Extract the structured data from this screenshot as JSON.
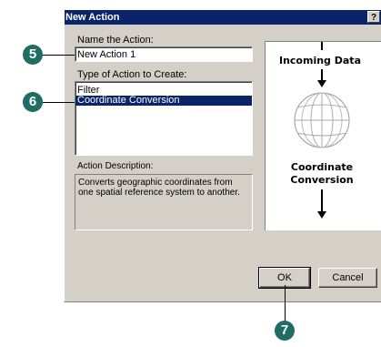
{
  "dialog": {
    "title": "New Action",
    "help_label": "?",
    "name_label": "Name  the Action:",
    "name_value": "New Action 1",
    "type_label": "Type of Action to Create:",
    "action_types": [
      "Filter",
      "Coordinate Conversion"
    ],
    "selected_type": "Coordinate Conversion",
    "description_label": "Action Description:",
    "description": "Converts geographic coordinates from one spatial reference system to another.",
    "diagram": {
      "top_label": "Incoming  Data",
      "bottom_label_line1": "Coordinate",
      "bottom_label_line2": "Conversion",
      "icon": "globe-icon"
    },
    "ok_label": "OK",
    "cancel_label": "Cancel"
  },
  "callouts": [
    "5",
    "6",
    "7"
  ]
}
